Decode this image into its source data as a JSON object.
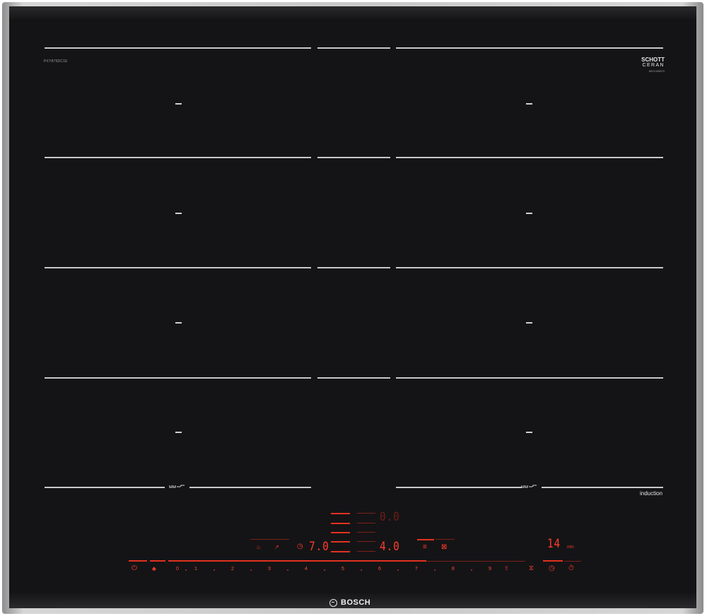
{
  "appliance": {
    "model_label": "PXY875DC1E",
    "glass_brand_line1": "SCHOTT",
    "glass_brand_line2": "CERAN",
    "glass_brand_line3": "6821008870",
    "induction_label": "induction",
    "brand": "BOSCH"
  },
  "display": {
    "power_level_top": "0.0",
    "power_level_bottom": "4.0",
    "timer_left": "7.0",
    "timer_right": "14",
    "timer_right_unit": "min"
  },
  "slider": {
    "labels": [
      "0",
      "1",
      "2",
      "3",
      "4",
      "5",
      "6",
      "7",
      "8",
      "9"
    ]
  },
  "icons": {
    "power": "power-icon",
    "child_lock": "child-lock-icon",
    "boost": "boost-icon",
    "timer": "timer-icon",
    "stopwatch": "stopwatch-icon",
    "menu": "menu-icon",
    "keep_warm": "keep-warm-icon",
    "flex_zone": "flexinduction-icon"
  },
  "colors": {
    "glass": "#141416",
    "display_red": "#ff3b2a",
    "frame": "#c9c9c9"
  }
}
